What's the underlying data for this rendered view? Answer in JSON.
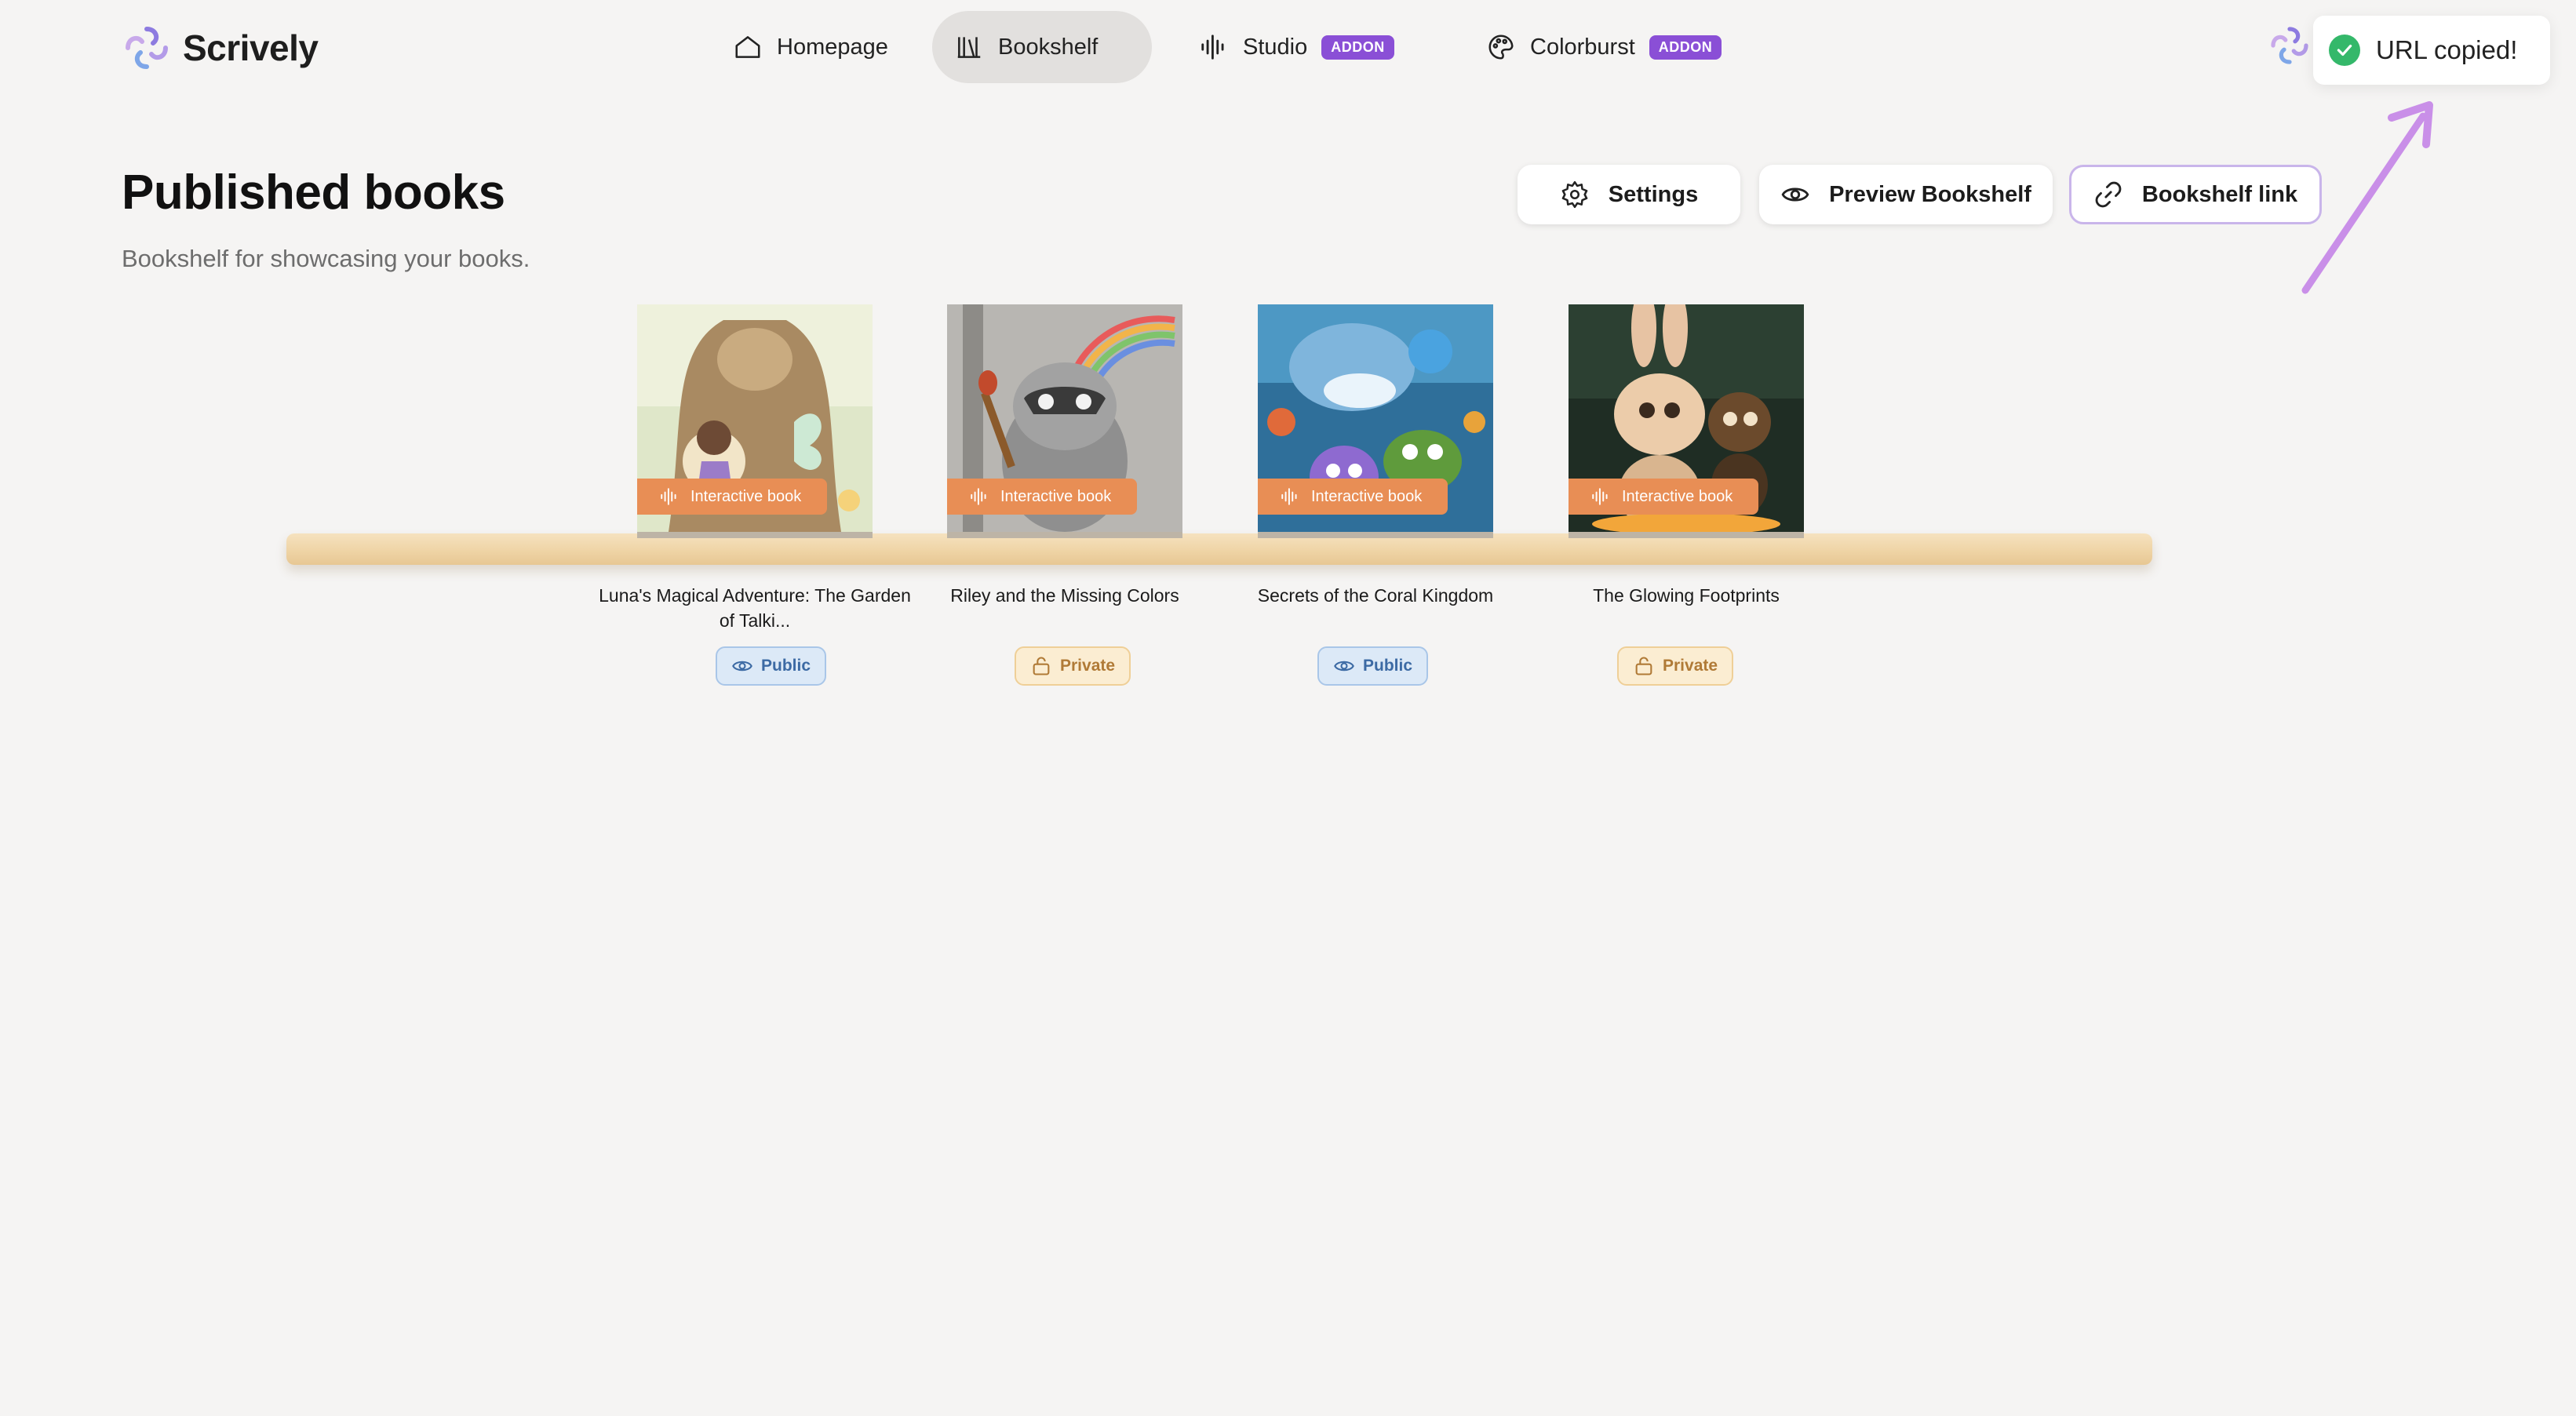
{
  "app": {
    "name": "Scrively"
  },
  "nav": {
    "items": [
      {
        "label": "Homepage",
        "icon": "home-icon"
      },
      {
        "label": "Bookshelf",
        "icon": "bookshelf-icon",
        "active": true
      },
      {
        "label": "Studio",
        "icon": "audio-wave-icon",
        "badge": "ADDON"
      },
      {
        "label": "Colorburst",
        "icon": "palette-icon",
        "badge": "ADDON"
      }
    ]
  },
  "toast": {
    "text": "URL copied!",
    "icon": "check-circle-icon"
  },
  "header": {
    "title": "Published books",
    "subtitle": "Bookshelf for showcasing your books."
  },
  "actions": {
    "settings": "Settings",
    "preview": "Preview Bookshelf",
    "link": "Bookshelf link"
  },
  "books": [
    {
      "title": "Luna's Magical Adventure: The Garden of Talki...",
      "badge": "Interactive book",
      "status": "Public"
    },
    {
      "title": "Riley and the Missing Colors",
      "badge": "Interactive book",
      "status": "Private"
    },
    {
      "title": "Secrets of the Coral Kingdom",
      "badge": "Interactive book",
      "status": "Public"
    },
    {
      "title": "The Glowing Footprints",
      "badge": "Interactive book",
      "status": "Private"
    }
  ],
  "colors": {
    "accent": "#8a4fd6",
    "interactive_badge": "#e88e55",
    "public": "#3c6aa4",
    "private": "#b07a36",
    "success": "#34b86a"
  }
}
